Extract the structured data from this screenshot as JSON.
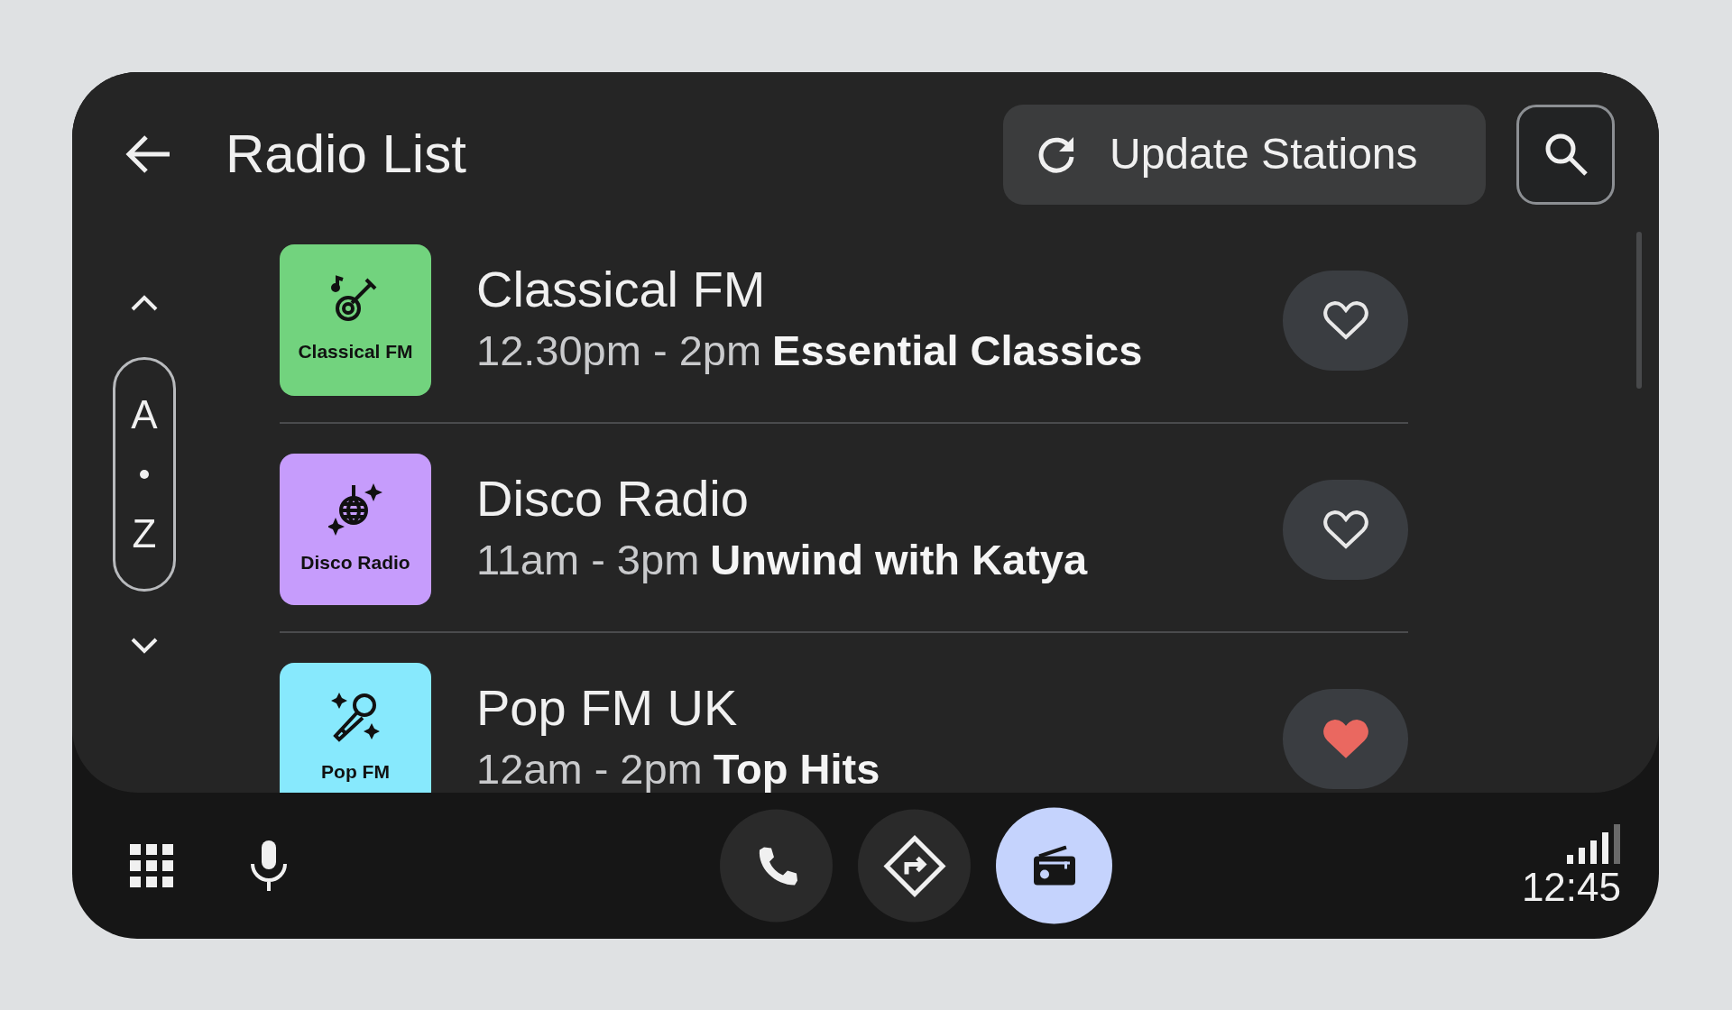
{
  "header": {
    "title": "Radio List",
    "update_button": "Update Stations"
  },
  "az_index": {
    "top_letter": "A",
    "bottom_letter": "Z"
  },
  "stations": [
    {
      "tile_label": "Classical FM",
      "kind": "guitar",
      "color": "#72d37e",
      "name": "Classical FM",
      "time": "12.30pm - 2pm",
      "show": "Essential Classics",
      "favorite": false
    },
    {
      "tile_label": "Disco Radio",
      "kind": "disco",
      "color": "#c69cfc",
      "name": "Disco Radio",
      "time": "11am - 3pm",
      "show": "Unwind with Katya",
      "favorite": false
    },
    {
      "tile_label": "Pop FM",
      "kind": "microphone",
      "color": "#87e9fd",
      "name": "Pop FM UK",
      "time": "12am - 2pm",
      "show": "Top Hits",
      "favorite": true
    }
  ],
  "nav_buttons": [
    {
      "kind": "phone",
      "selected": false
    },
    {
      "kind": "navigation",
      "selected": false
    },
    {
      "kind": "radio",
      "selected": true
    }
  ],
  "status": {
    "time": "12:45"
  }
}
